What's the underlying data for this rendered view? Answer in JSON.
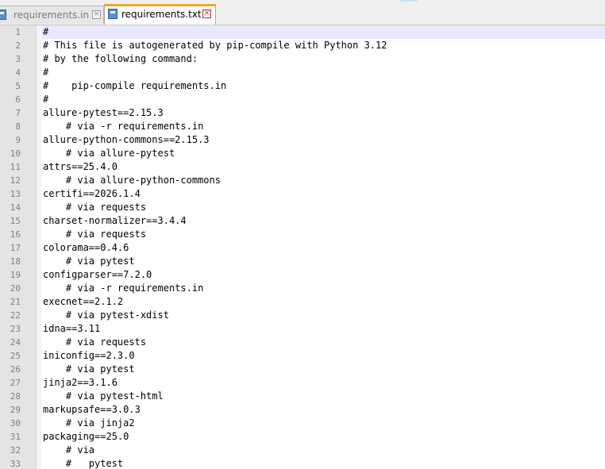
{
  "tabs": [
    {
      "label": "requirements.in",
      "active": false,
      "close_glyph": "×"
    },
    {
      "label": "requirements.txt",
      "active": true,
      "close_glyph": "×"
    }
  ],
  "editor": {
    "current_line": 1,
    "lines": [
      {
        "n": "1",
        "text": "#"
      },
      {
        "n": "2",
        "text": "# This file is autogenerated by pip-compile with Python 3.12"
      },
      {
        "n": "3",
        "text": "# by the following command:"
      },
      {
        "n": "4",
        "text": "#"
      },
      {
        "n": "5",
        "text": "#    pip-compile requirements.in"
      },
      {
        "n": "6",
        "text": "#"
      },
      {
        "n": "7",
        "text": "allure-pytest==2.15.3"
      },
      {
        "n": "8",
        "text": "    # via -r requirements.in"
      },
      {
        "n": "9",
        "text": "allure-python-commons==2.15.3"
      },
      {
        "n": "10",
        "text": "    # via allure-pytest"
      },
      {
        "n": "11",
        "text": "attrs==25.4.0"
      },
      {
        "n": "12",
        "text": "    # via allure-python-commons"
      },
      {
        "n": "13",
        "text": "certifi==2026.1.4"
      },
      {
        "n": "14",
        "text": "    # via requests"
      },
      {
        "n": "15",
        "text": "charset-normalizer==3.4.4"
      },
      {
        "n": "16",
        "text": "    # via requests"
      },
      {
        "n": "17",
        "text": "colorama==0.4.6"
      },
      {
        "n": "18",
        "text": "    # via pytest"
      },
      {
        "n": "19",
        "text": "configparser==7.2.0"
      },
      {
        "n": "20",
        "text": "    # via -r requirements.in"
      },
      {
        "n": "21",
        "text": "execnet==2.1.2"
      },
      {
        "n": "22",
        "text": "    # via pytest-xdist"
      },
      {
        "n": "23",
        "text": "idna==3.11"
      },
      {
        "n": "24",
        "text": "    # via requests"
      },
      {
        "n": "25",
        "text": "iniconfig==2.3.0"
      },
      {
        "n": "26",
        "text": "    # via pytest"
      },
      {
        "n": "27",
        "text": "jinja2==3.1.6"
      },
      {
        "n": "28",
        "text": "    # via pytest-html"
      },
      {
        "n": "29",
        "text": "markupsafe==3.0.3"
      },
      {
        "n": "30",
        "text": "    # via jinja2"
      },
      {
        "n": "31",
        "text": "packaging==25.0"
      },
      {
        "n": "32",
        "text": "    # via"
      },
      {
        "n": "33",
        "text": "    #   pytest"
      }
    ]
  }
}
